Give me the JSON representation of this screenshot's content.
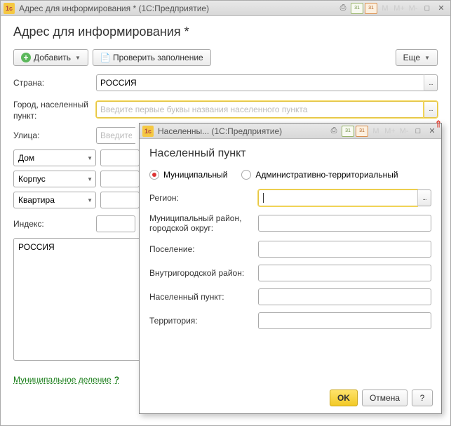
{
  "main": {
    "titlebar": "Адрес для информирования *  (1С:Предприятие)",
    "page_title": "Адрес для информирования *",
    "toolbar": {
      "add": "Добавить",
      "check": "Проверить заполнение",
      "more": "Еще"
    },
    "labels": {
      "country": "Страна:",
      "city": "Город, населенный пункт:",
      "street": "Улица:",
      "index": "Индекс:"
    },
    "placeholders": {
      "city": "Введите первые буквы названия населенного пункта",
      "street": "Введите первые буквы названия улицы"
    },
    "values": {
      "country": "РОССИЯ",
      "address_text": "РОССИЯ"
    },
    "components": {
      "house": "Дом",
      "building": "Корпус",
      "flat": "Квартира"
    },
    "bottom_link": "Муниципальное деление"
  },
  "popup": {
    "titlebar": "Населенны...  (1С:Предприятие)",
    "title": "Населенный пункт",
    "radio": {
      "municipal": "Муниципальный",
      "admin": "Административно-территориальный"
    },
    "labels": {
      "region": "Регион:",
      "district": "Муниципальный район, городской округ:",
      "settlement": "Поселение:",
      "inner_district": "Внутригородской район:",
      "locality": "Населенный пункт:",
      "territory": "Территория:"
    },
    "buttons": {
      "ok": "OK",
      "cancel": "Отмена",
      "help": "?"
    }
  },
  "icons": {
    "logo": "1c",
    "m": "M",
    "mplus": "M+",
    "mminus": "M-",
    "cal": "31"
  }
}
